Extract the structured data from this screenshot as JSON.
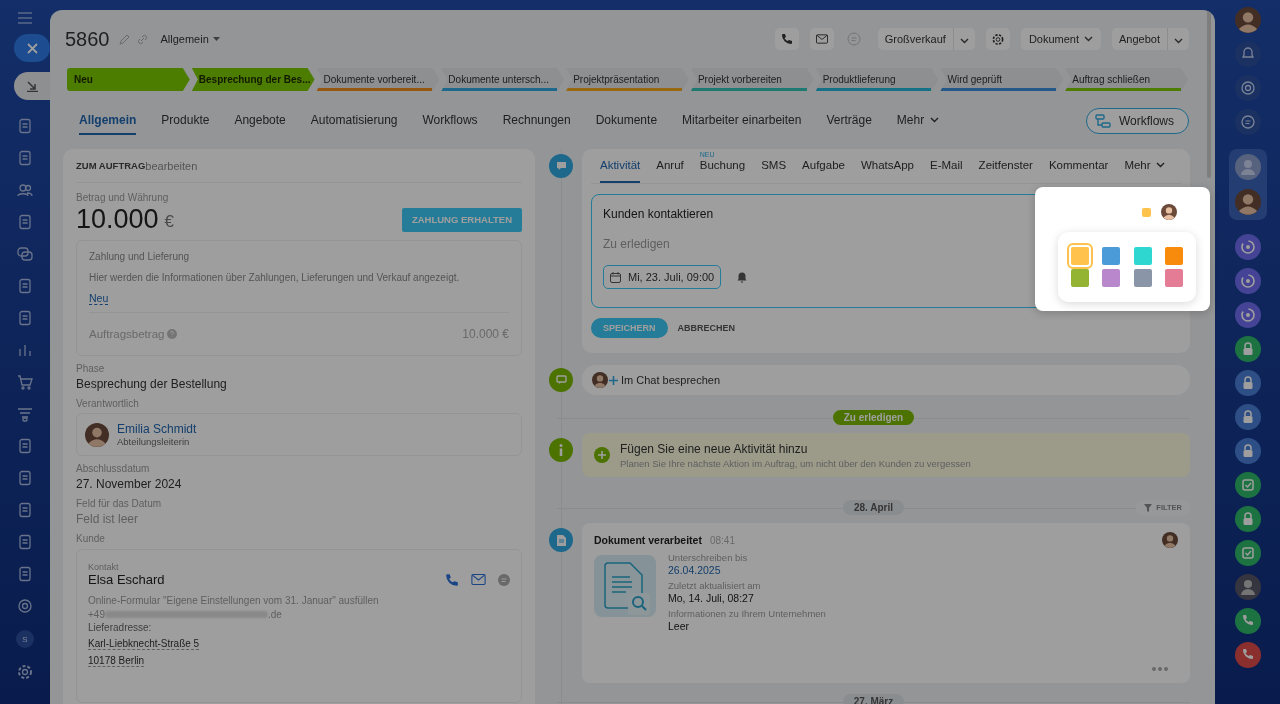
{
  "header": {
    "title": "5860",
    "category": "Allgemein",
    "funnel": "Großverkauf",
    "document_button": "Dokument",
    "offer_button": "Angebot"
  },
  "stages": [
    {
      "label": "Neu",
      "reached": true,
      "color": "#4c7c00"
    },
    {
      "label": "Besprechung der Bes...",
      "reached": true,
      "color": "#4c7c00"
    },
    {
      "label": "Dokumente vorbereit...",
      "reached": false,
      "color": "#965711"
    },
    {
      "label": "Dokumente untersch...",
      "reached": false,
      "color": "#1d688b"
    },
    {
      "label": "Projektpräsentation",
      "reached": false,
      "color": "#98670f"
    },
    {
      "label": "Projekt vorbereiten",
      "reached": false,
      "color": "#1d7971"
    },
    {
      "label": "Produktlieferung",
      "reached": false,
      "color": "#177186"
    },
    {
      "label": "Wird geprüft",
      "reached": false,
      "color": "#24588b"
    },
    {
      "label": "Auftrag schließen",
      "reached": false,
      "color": "#4c7c00"
    }
  ],
  "tabs": [
    {
      "label": "Allgemein",
      "selected": true
    },
    {
      "label": "Produkte",
      "selected": false
    },
    {
      "label": "Angebote",
      "selected": false
    },
    {
      "label": "Automatisierung",
      "selected": false
    },
    {
      "label": "Workflows",
      "selected": false
    },
    {
      "label": "Rechnungen",
      "selected": false
    },
    {
      "label": "Dokumente",
      "selected": false
    },
    {
      "label": "Mitarbeiter einarbeiten",
      "selected": false
    },
    {
      "label": "Verträge",
      "selected": false
    },
    {
      "label": "Mehr",
      "selected": false
    }
  ],
  "workflows_button": "Workflows",
  "order_card": {
    "title": "ZUM AUFTRAG",
    "edit": "bearbeiten",
    "amount_label": "Betrag und Währung",
    "amount": "10.000",
    "currency": "€",
    "pay_button": "ZAHLUNG ERHALTEN",
    "payment": {
      "title": "Zahlung und Lieferung",
      "text": "Hier werden die Informationen über Zahlungen, Lieferungen und Verkauf angezeigt.",
      "link": "Neu",
      "total_label": "Auftragsbetrag",
      "total": "10.000 €"
    },
    "phase_label": "Phase",
    "phase": "Besprechung der Bestellung",
    "responsible_label": "Verantwortlich",
    "responsible_name": "Emilia Schmidt",
    "responsible_role": "Abteilungsleiterin",
    "close_date_label": "Abschlussdatum",
    "close_date": "27. November 2024",
    "date_field_label": "Feld für das Datum",
    "date_field": "Feld ist leer",
    "client_label": "Kunde",
    "contact": {
      "label": "Kontakt",
      "name": "Elsa Eschard",
      "source": "Online-Formular \"Eigene Einstellungen vom 31. Januar\" ausfüllen",
      "phone_start": "+49",
      "email_end": ".de",
      "address_label": "Lieferadresse:",
      "street": "Karl-Liebknecht-Straße 5",
      "city": "10178 Berlin"
    }
  },
  "activity_tabs": [
    {
      "label": "Aktivität",
      "selected": true
    },
    {
      "label": "Anruf",
      "selected": false
    },
    {
      "label": "Buchung",
      "selected": false,
      "badge": "NEU"
    },
    {
      "label": "SMS",
      "selected": false
    },
    {
      "label": "Aufgabe",
      "selected": false
    },
    {
      "label": "WhatsApp",
      "selected": false
    },
    {
      "label": "E-Mail",
      "selected": false
    },
    {
      "label": "Zeitfenster",
      "selected": false
    },
    {
      "label": "Kommentar",
      "selected": false
    },
    {
      "label": "Mehr",
      "selected": false
    }
  ],
  "task": {
    "title": "Kunden kontaktieren",
    "placeholder": "Zu erledigen",
    "date": "Mi, 23. Juli, 09:00",
    "color": "#ffc34d",
    "save": "SPEICHERN",
    "cancel": "ABBRECHEN"
  },
  "color_picker": {
    "swatches": [
      {
        "color": "#ffc34d",
        "selected": true
      },
      {
        "color": "#4a9bd8",
        "selected": false
      },
      {
        "color": "#2ed8d0",
        "selected": false
      },
      {
        "color": "#f88a0c",
        "selected": false
      },
      {
        "color": "#93b332",
        "selected": false
      },
      {
        "color": "#b987cc",
        "selected": false
      },
      {
        "color": "#8a96a8",
        "selected": false
      },
      {
        "color": "#e57c96",
        "selected": false
      }
    ]
  },
  "chat_item": "Im Chat besprechen",
  "todo_divider": "Zu erledigen",
  "add_activity": {
    "title": "Fügen Sie eine neue Aktivität hinzu",
    "text": "Planen Sie Ihre nächste Aktion im Auftrag, um nicht über den Kunden zu vergessen"
  },
  "date_divider": "28. April",
  "filter": "FILTER",
  "document_item": {
    "title": "Dokument verarbeitet",
    "time": "08:41",
    "sign_label": "Unterschreiben bis",
    "sign_date": "26.04.2025",
    "updated_label": "Zuletzt aktualisiert am",
    "updated": "Mo, 14. Juli, 08:27",
    "company_label": "Informationen zu Ihrem Unternehmen",
    "company": "Leer"
  },
  "next_date_divider": "27. März",
  "left_sidebar": {
    "badge": "S"
  }
}
